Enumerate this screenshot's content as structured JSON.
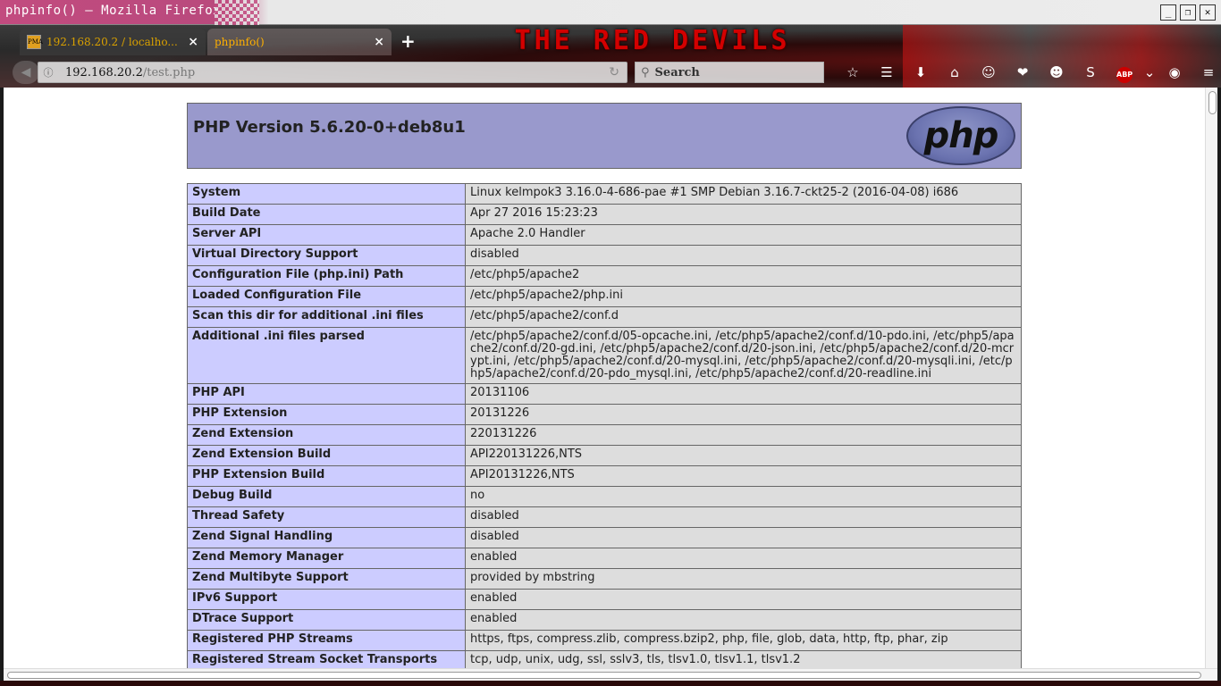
{
  "window": {
    "title": "phpinfo() — Mozilla Firefox",
    "buttons": [
      "_",
      "❐",
      "✕"
    ]
  },
  "theme": {
    "banner": "THE RED DEVILS",
    "accent": "#d30000"
  },
  "tabs": [
    {
      "label": "192.168.20.2 / localho...",
      "favicon": "PMA",
      "close": "×"
    },
    {
      "label": "phpinfo()",
      "close": "×"
    }
  ],
  "newtab": "+",
  "nav": {
    "url_host": "192.168.20.2",
    "url_path": "/test.php",
    "search_placeholder": "Search"
  },
  "toolbar_icons": [
    "star-icon",
    "reader-list-icon",
    "download-icon",
    "home-icon",
    "smiley-icon",
    "pocket-icon",
    "emoji-icon",
    "s-extension-icon",
    "adblock-icon",
    "chevron-down-icon",
    "color-wheel-icon",
    "menu-icon"
  ],
  "toolbar_glyphs": [
    "☆",
    "☰",
    "⬇",
    "⌂",
    "☺",
    "❤",
    "☻",
    "S",
    "ABP",
    "⌄",
    "◉",
    "≡"
  ],
  "php": {
    "version": "PHP Version 5.6.20-0+deb8u1",
    "logo": "php",
    "rows": [
      {
        "k": "System",
        "v": "Linux kelmpok3 3.16.0-4-686-pae #1 SMP Debian 3.16.7-ckt25-2 (2016-04-08) i686"
      },
      {
        "k": "Build Date",
        "v": "Apr 27 2016 15:23:23"
      },
      {
        "k": "Server API",
        "v": "Apache 2.0 Handler"
      },
      {
        "k": "Virtual Directory Support",
        "v": "disabled"
      },
      {
        "k": "Configuration File (php.ini) Path",
        "v": "/etc/php5/apache2"
      },
      {
        "k": "Loaded Configuration File",
        "v": "/etc/php5/apache2/php.ini"
      },
      {
        "k": "Scan this dir for additional .ini files",
        "v": "/etc/php5/apache2/conf.d"
      },
      {
        "k": "Additional .ini files parsed",
        "v": "/etc/php5/apache2/conf.d/05-opcache.ini, /etc/php5/apache2/conf.d/10-pdo.ini, /etc/php5/apache2/conf.d/20-gd.ini, /etc/php5/apache2/conf.d/20-json.ini, /etc/php5/apache2/conf.d/20-mcrypt.ini, /etc/php5/apache2/conf.d/20-mysql.ini, /etc/php5/apache2/conf.d/20-mysqli.ini, /etc/php5/apache2/conf.d/20-pdo_mysql.ini, /etc/php5/apache2/conf.d/20-readline.ini"
      },
      {
        "k": "PHP API",
        "v": "20131106"
      },
      {
        "k": "PHP Extension",
        "v": "20131226"
      },
      {
        "k": "Zend Extension",
        "v": "220131226"
      },
      {
        "k": "Zend Extension Build",
        "v": "API220131226,NTS"
      },
      {
        "k": "PHP Extension Build",
        "v": "API20131226,NTS"
      },
      {
        "k": "Debug Build",
        "v": "no"
      },
      {
        "k": "Thread Safety",
        "v": "disabled"
      },
      {
        "k": "Zend Signal Handling",
        "v": "disabled"
      },
      {
        "k": "Zend Memory Manager",
        "v": "enabled"
      },
      {
        "k": "Zend Multibyte Support",
        "v": "provided by mbstring"
      },
      {
        "k": "IPv6 Support",
        "v": "enabled"
      },
      {
        "k": "DTrace Support",
        "v": "enabled"
      },
      {
        "k": "Registered PHP Streams",
        "v": "https, ftps, compress.zlib, compress.bzip2, php, file, glob, data, http, ftp, phar, zip"
      },
      {
        "k": "Registered Stream Socket Transports",
        "v": "tcp, udp, unix, udg, ssl, sslv3, tls, tlsv1.0, tlsv1.1, tlsv1.2"
      }
    ]
  }
}
